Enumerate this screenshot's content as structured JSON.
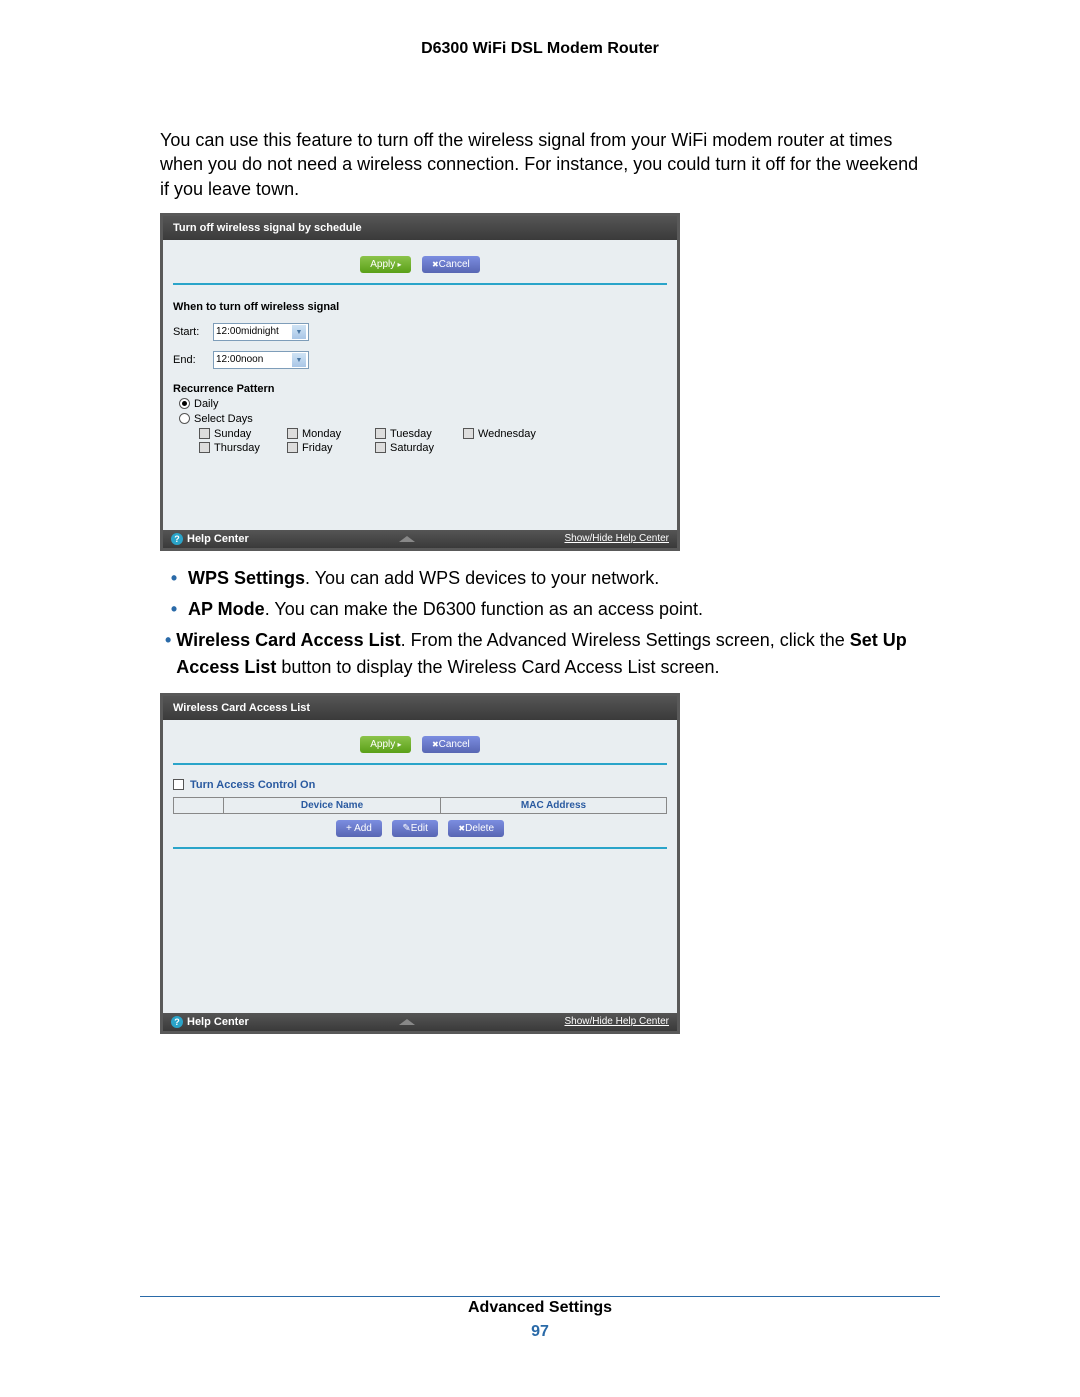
{
  "header": {
    "title": "D6300 WiFi DSL Modem Router"
  },
  "intro": "You can use this feature to turn off the wireless signal from your WiFi modem router at times when you do not need a wireless connection. For instance, you could turn it off for the weekend if you leave town.",
  "screenshot1": {
    "title": "Turn off wireless signal by schedule",
    "apply": "Apply",
    "cancel": "Cancel",
    "when_label": "When to turn off wireless signal",
    "start_label": "Start:",
    "start_value": "12:00midnight",
    "end_label": "End:",
    "end_value": "12:00noon",
    "recurrence_label": "Recurrence Pattern",
    "daily": "Daily",
    "select_days": "Select Days",
    "days_row1": [
      "Sunday",
      "Monday",
      "Tuesday",
      "Wednesday"
    ],
    "days_row2": [
      "Thursday",
      "Friday",
      "Saturday"
    ],
    "help_center": "Help Center",
    "showhide": "Show/Hide Help Center"
  },
  "bullets": {
    "b1_bold": "WPS Settings",
    "b1_rest": ". You can add WPS devices to your network.",
    "b2_bold": "AP Mode",
    "b2_rest": ". You can make the D6300 function as an access point.",
    "b3_bold": "Wireless Card Access List",
    "b3_mid": ". From the Advanced Wireless Settings screen, click the ",
    "b3_bold2": "Set Up Access List",
    "b3_rest": " button to display the Wireless Card Access List screen."
  },
  "screenshot2": {
    "title": "Wireless Card Access List",
    "apply": "Apply",
    "cancel": "Cancel",
    "turn_on": "Turn Access Control On",
    "col_device": "Device Name",
    "col_mac": "MAC Address",
    "add": "Add",
    "edit": "Edit",
    "delete": "Delete",
    "help_center": "Help Center",
    "showhide": "Show/Hide Help Center"
  },
  "footer": {
    "section": "Advanced Settings",
    "page": "97"
  }
}
